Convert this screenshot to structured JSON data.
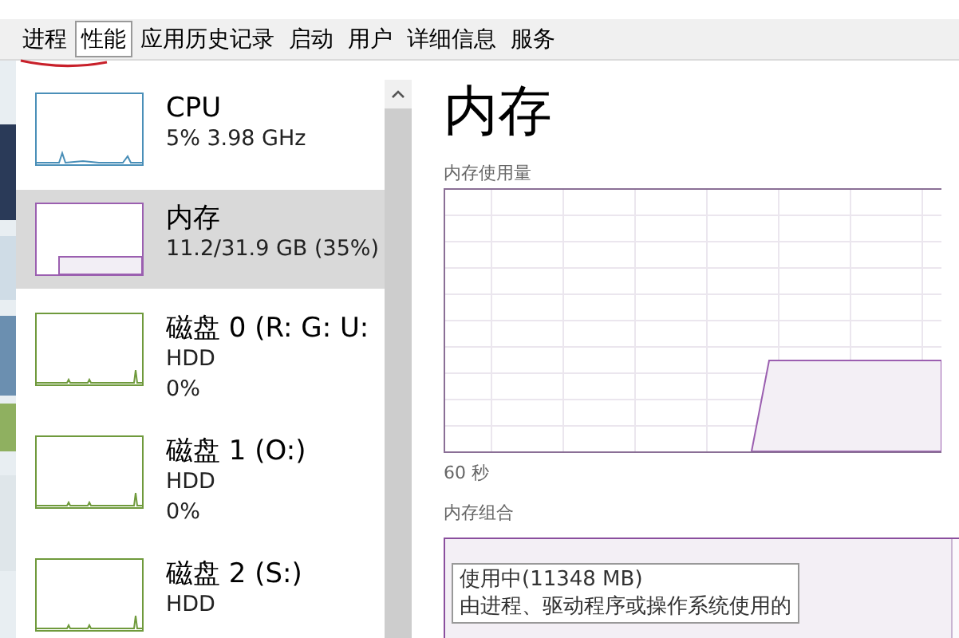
{
  "tabs": [
    {
      "label": "进程",
      "selected": false
    },
    {
      "label": "性能",
      "selected": true
    },
    {
      "label": "应用历史记录",
      "selected": false
    },
    {
      "label": "启动",
      "selected": false
    },
    {
      "label": "用户",
      "selected": false
    },
    {
      "label": "详细信息",
      "selected": false
    },
    {
      "label": "服务",
      "selected": false
    }
  ],
  "sidebar": {
    "items": [
      {
        "kind": "cpu",
        "title": "CPU",
        "lines": [
          "5%  3.98 GHz"
        ],
        "color": "#4a8fb8",
        "selected": false
      },
      {
        "kind": "memory",
        "title": "内存",
        "lines": [
          "11.2/31.9 GB (35%)"
        ],
        "color": "#9b5fb0",
        "selected": true
      },
      {
        "kind": "disk",
        "title": "磁盘 0 (R: G: U:",
        "lines": [
          "HDD",
          "0%"
        ],
        "color": "#6f9a3c",
        "selected": false
      },
      {
        "kind": "disk",
        "title": "磁盘 1 (O:)",
        "lines": [
          "HDD",
          "0%"
        ],
        "color": "#6f9a3c",
        "selected": false
      },
      {
        "kind": "disk",
        "title": "磁盘 2 (S:)",
        "lines": [
          "HDD"
        ],
        "color": "#6f9a3c",
        "selected": false
      }
    ]
  },
  "detail": {
    "title": "内存",
    "usage_label": "内存使用量",
    "time_label": "60 秒",
    "composition_label": "内存组合",
    "tooltip": {
      "title": "使用中(11348 MB)",
      "description": "由进程、驱动程序或操作系统使用的"
    }
  }
}
